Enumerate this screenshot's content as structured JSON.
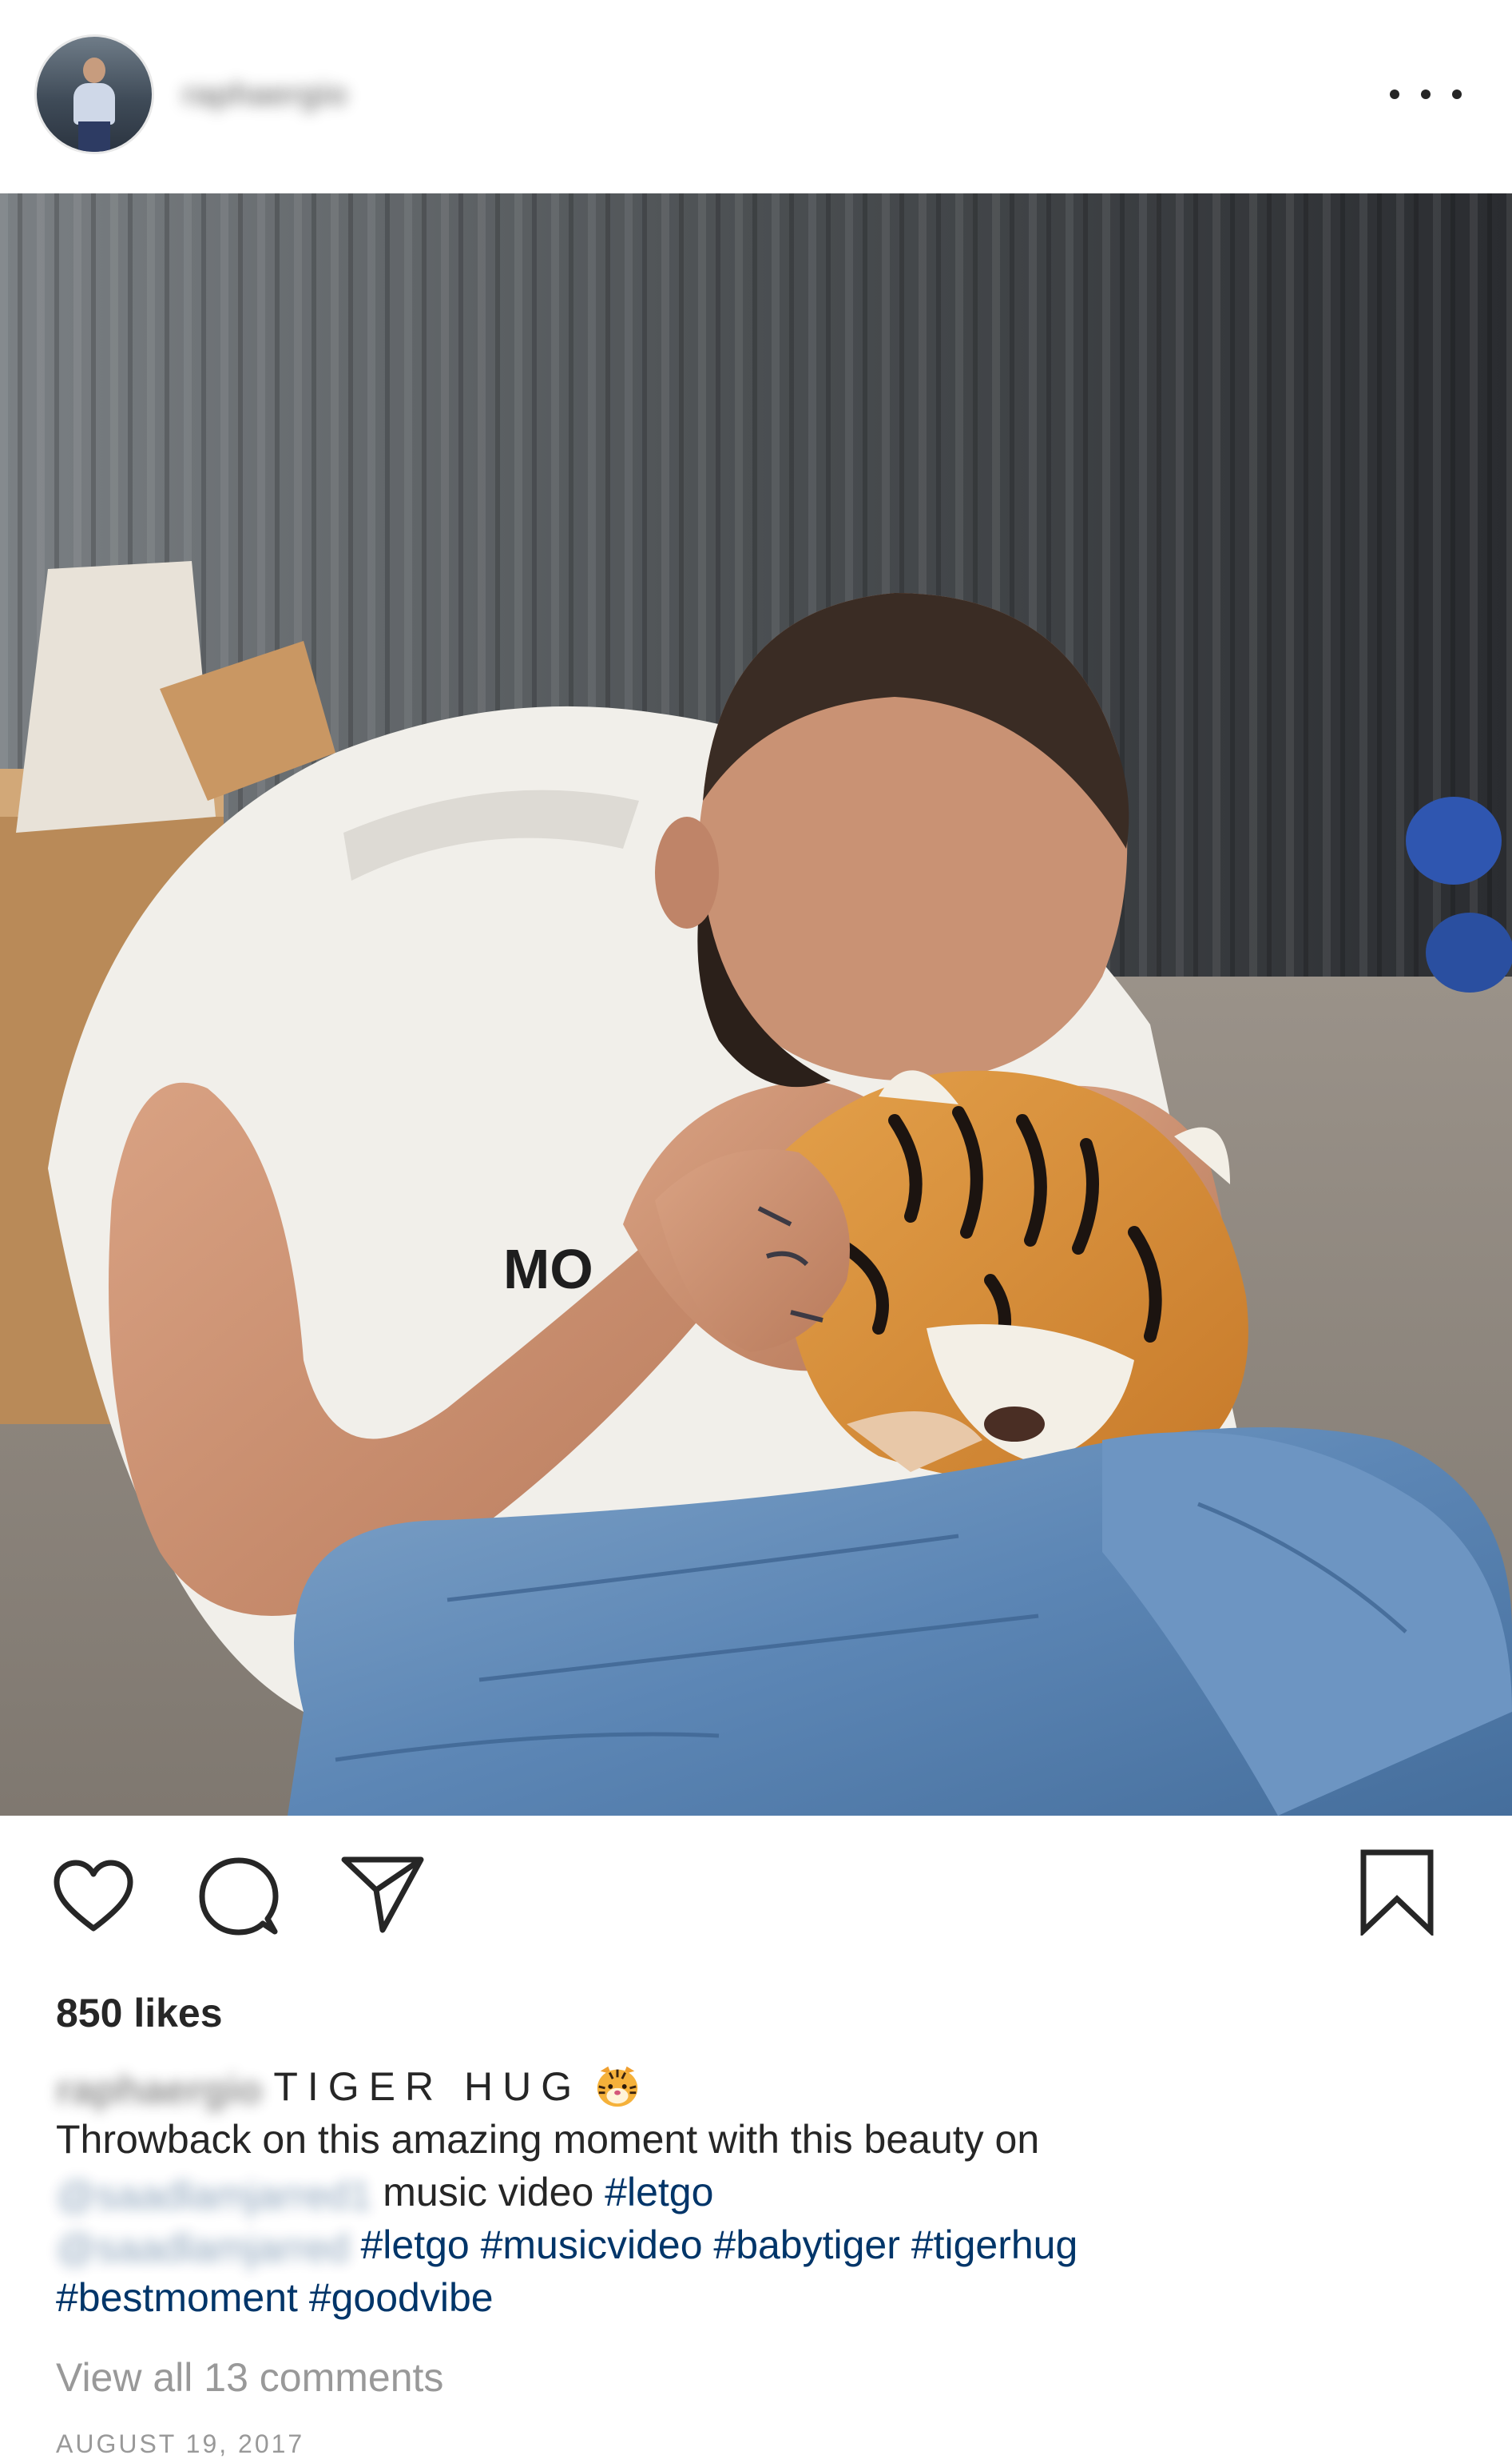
{
  "header": {
    "username": "raphaergio",
    "more_icon": "more-horizontal-icon"
  },
  "photo": {
    "shirt_text": "MO"
  },
  "actions": {
    "like_icon": "heart-icon",
    "comment_icon": "comment-bubble-icon",
    "share_icon": "paper-plane-icon",
    "save_icon": "bookmark-icon"
  },
  "likes": "850 likes",
  "caption": {
    "username": "raphaergio",
    "title": "TIGER HUG",
    "emoji": "tiger-face-emoji",
    "line1": "Throwback on this amazing moment with this beauty on",
    "mention1": "@saadlamjarred1",
    "line2_text": " music video ",
    "line2_hashtag": "#letgo",
    "mention2": "@saadlamjarred",
    "line3_hashtags": " #letgo #musicvideo #babytiger #tigerhug",
    "line4_hashtags": "#bestmoment #goodvibe"
  },
  "view_comments": "View all 13 comments",
  "date": "AUGUST 19, 2017",
  "colors": {
    "text": "#262626",
    "link": "#003569",
    "muted": "#999999",
    "background": "#ffffff"
  }
}
